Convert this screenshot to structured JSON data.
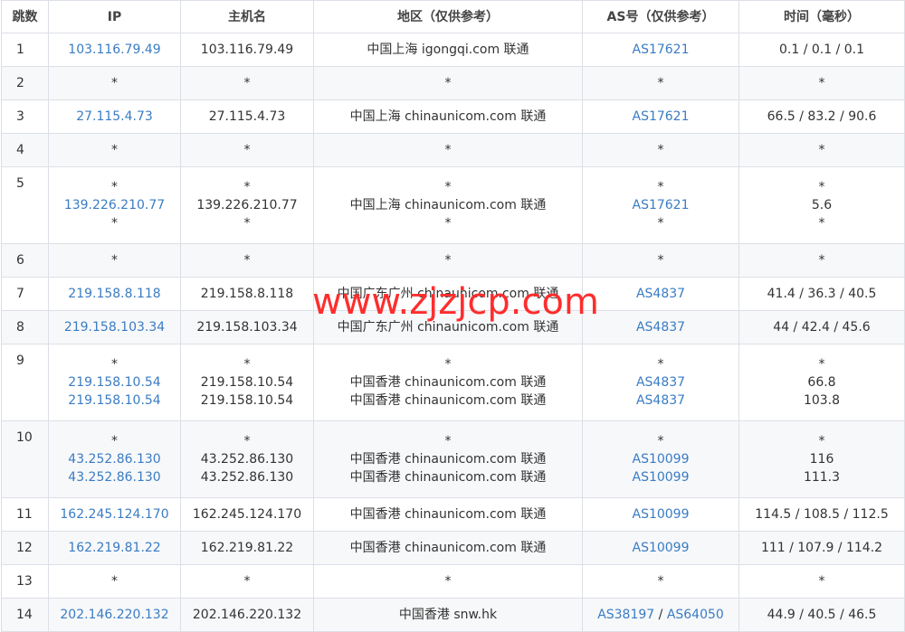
{
  "colors": {
    "link": "#3a7cc3",
    "watermark": "#ff2d2d",
    "border": "#dcdfe6"
  },
  "headers": [
    "跳数",
    "IP",
    "主机名",
    "地区（仅供参考）",
    "AS号（仅供参考）",
    "时间（毫秒）"
  ],
  "rows": [
    {
      "hop": "1",
      "ip": [
        "103.116.79.49"
      ],
      "host": [
        "103.116.79.49"
      ],
      "region": [
        "中国上海 igongqi.com 联通"
      ],
      "as": [
        [
          "AS17621"
        ]
      ],
      "time": [
        "0.1 / 0.1 / 0.1"
      ]
    },
    {
      "hop": "2",
      "ip": [
        "*"
      ],
      "host": [
        "*"
      ],
      "region": [
        "*"
      ],
      "as": [
        [
          "*"
        ]
      ],
      "time": [
        "*"
      ]
    },
    {
      "hop": "3",
      "ip": [
        "27.115.4.73"
      ],
      "host": [
        "27.115.4.73"
      ],
      "region": [
        "中国上海 chinaunicom.com 联通"
      ],
      "as": [
        [
          "AS17621"
        ]
      ],
      "time": [
        "66.5 / 83.2 / 90.6"
      ]
    },
    {
      "hop": "4",
      "ip": [
        "*"
      ],
      "host": [
        "*"
      ],
      "region": [
        "*"
      ],
      "as": [
        [
          "*"
        ]
      ],
      "time": [
        "*"
      ]
    },
    {
      "hop": "5",
      "ip": [
        "*",
        "139.226.210.77",
        "*"
      ],
      "host": [
        "*",
        "139.226.210.77",
        "*"
      ],
      "region": [
        "*",
        "中国上海 chinaunicom.com 联通",
        "*"
      ],
      "as": [
        [
          "*"
        ],
        [
          "AS17621"
        ],
        [
          "*"
        ]
      ],
      "time": [
        "*",
        "5.6",
        "*"
      ]
    },
    {
      "hop": "6",
      "ip": [
        "*"
      ],
      "host": [
        "*"
      ],
      "region": [
        "*"
      ],
      "as": [
        [
          "*"
        ]
      ],
      "time": [
        "*"
      ]
    },
    {
      "hop": "7",
      "ip": [
        "219.158.8.118"
      ],
      "host": [
        "219.158.8.118"
      ],
      "region": [
        "中国广东广州 chinaunicom.com 联通"
      ],
      "as": [
        [
          "AS4837"
        ]
      ],
      "time": [
        "41.4 / 36.3 / 40.5"
      ]
    },
    {
      "hop": "8",
      "ip": [
        "219.158.103.34"
      ],
      "host": [
        "219.158.103.34"
      ],
      "region": [
        "中国广东广州 chinaunicom.com 联通"
      ],
      "as": [
        [
          "AS4837"
        ]
      ],
      "time": [
        "44 / 42.4 / 45.6"
      ]
    },
    {
      "hop": "9",
      "ip": [
        "*",
        "219.158.10.54",
        "219.158.10.54"
      ],
      "host": [
        "*",
        "219.158.10.54",
        "219.158.10.54"
      ],
      "region": [
        "*",
        "中国香港 chinaunicom.com 联通",
        "中国香港 chinaunicom.com 联通"
      ],
      "as": [
        [
          "*"
        ],
        [
          "AS4837"
        ],
        [
          "AS4837"
        ]
      ],
      "time": [
        "*",
        "66.8",
        "103.8"
      ]
    },
    {
      "hop": "10",
      "ip": [
        "*",
        "43.252.86.130",
        "43.252.86.130"
      ],
      "host": [
        "*",
        "43.252.86.130",
        "43.252.86.130"
      ],
      "region": [
        "*",
        "中国香港 chinaunicom.com 联通",
        "中国香港 chinaunicom.com 联通"
      ],
      "as": [
        [
          "*"
        ],
        [
          "AS10099"
        ],
        [
          "AS10099"
        ]
      ],
      "time": [
        "*",
        "116",
        "111.3"
      ]
    },
    {
      "hop": "11",
      "ip": [
        "162.245.124.170"
      ],
      "host": [
        "162.245.124.170"
      ],
      "region": [
        "中国香港 chinaunicom.com 联通"
      ],
      "as": [
        [
          "AS10099"
        ]
      ],
      "time": [
        "114.5 / 108.5 / 112.5"
      ]
    },
    {
      "hop": "12",
      "ip": [
        "162.219.81.22"
      ],
      "host": [
        "162.219.81.22"
      ],
      "region": [
        "中国香港 chinaunicom.com 联通"
      ],
      "as": [
        [
          "AS10099"
        ]
      ],
      "time": [
        "111 / 107.9 / 114.2"
      ]
    },
    {
      "hop": "13",
      "ip": [
        "*"
      ],
      "host": [
        "*"
      ],
      "region": [
        "*"
      ],
      "as": [
        [
          "*"
        ]
      ],
      "time": [
        "*"
      ]
    },
    {
      "hop": "14",
      "ip": [
        "202.146.220.132"
      ],
      "host": [
        "202.146.220.132"
      ],
      "region": [
        "中国香港 snw.hk"
      ],
      "as": [
        [
          "AS38197",
          "AS64050"
        ]
      ],
      "time": [
        "44.9 / 40.5 / 46.5"
      ]
    }
  ],
  "watermark": "www.zjzjcp.com"
}
